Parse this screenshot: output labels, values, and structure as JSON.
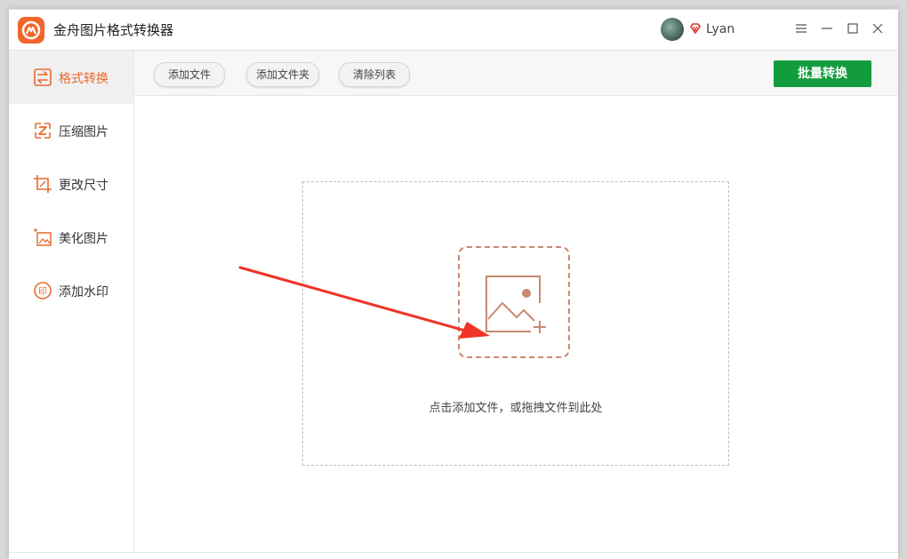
{
  "app": {
    "title": "金舟图片格式转换器",
    "accent": "#e9692d",
    "logo_color": "#f2662d"
  },
  "user": {
    "name": "Lyan"
  },
  "window_controls": [
    "menu-icon",
    "minimize-icon",
    "maximize-icon",
    "close-icon"
  ],
  "sidebar": {
    "items": [
      {
        "label": "格式转换",
        "icon": "convert-icon",
        "active": true
      },
      {
        "label": "压缩图片",
        "icon": "compress-icon",
        "active": false
      },
      {
        "label": "更改尺寸",
        "icon": "resize-icon",
        "active": false
      },
      {
        "label": "美化图片",
        "icon": "beautify-icon",
        "active": false
      },
      {
        "label": "添加水印",
        "icon": "watermark-icon",
        "active": false
      }
    ]
  },
  "toolbar": {
    "add_file": "添加文件",
    "add_folder": "添加文件夹",
    "clear_list": "清除列表",
    "batch_convert": "批量转换",
    "batch_color": "#129c3e"
  },
  "dropzone": {
    "hint": "点击添加文件，或拖拽文件到此处"
  }
}
